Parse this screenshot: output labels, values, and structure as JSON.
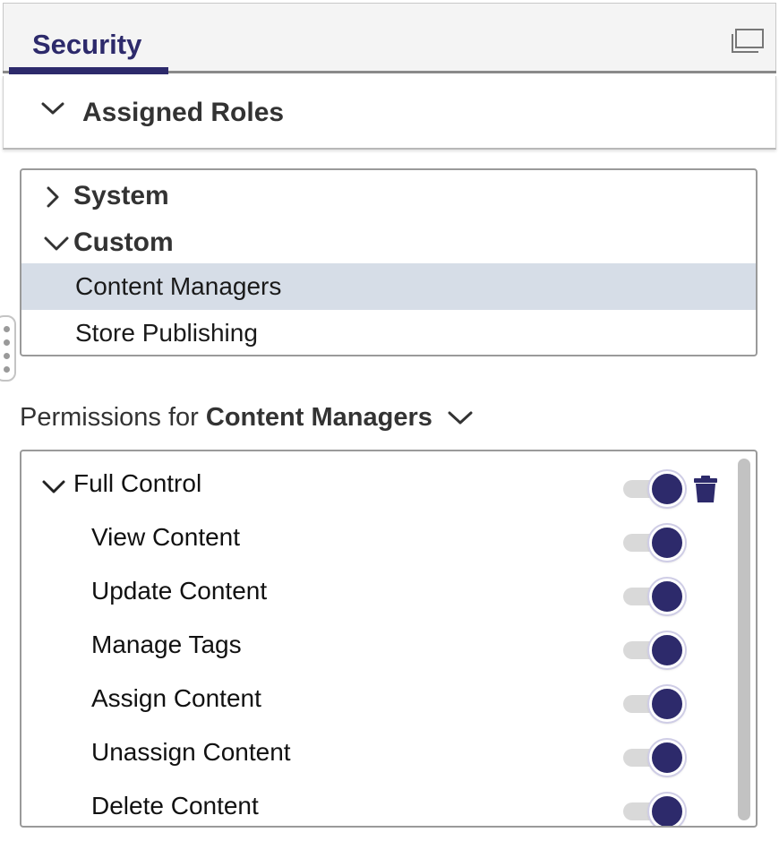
{
  "tab": {
    "label": "Security",
    "active": true,
    "accent_color": "#2d2a6b",
    "maximize_icon": "maximize-icon"
  },
  "assigned_roles": {
    "label": "Assigned Roles",
    "expanded": true,
    "chevron_icon": "chevron-down-icon"
  },
  "roles_tree": {
    "groups": [
      {
        "label": "System",
        "expanded": false,
        "chevron_icon": "chevron-right-icon"
      },
      {
        "label": "Custom",
        "expanded": true,
        "chevron_icon": "chevron-down-icon"
      }
    ],
    "items": [
      {
        "label": "Content Managers",
        "selected": true
      },
      {
        "label": "Store Publishing",
        "selected": false
      }
    ],
    "selected_color": "#d6dde7"
  },
  "permissions": {
    "prefix": "Permissions for",
    "role": "Content Managers",
    "chevron_icon": "chevron-down-icon",
    "parent": {
      "label": "Full Control",
      "enabled": true,
      "delete_icon": "trash-icon"
    },
    "children": [
      {
        "label": "View Content",
        "enabled": true
      },
      {
        "label": "Update Content",
        "enabled": true
      },
      {
        "label": "Manage Tags",
        "enabled": true
      },
      {
        "label": "Assign Content",
        "enabled": true
      },
      {
        "label": "Unassign Content",
        "enabled": true
      },
      {
        "label": "Delete Content",
        "enabled": true
      }
    ],
    "toggle_on_color": "#2d2a6b"
  },
  "resize_handle_icon": "drag-handle-icon"
}
